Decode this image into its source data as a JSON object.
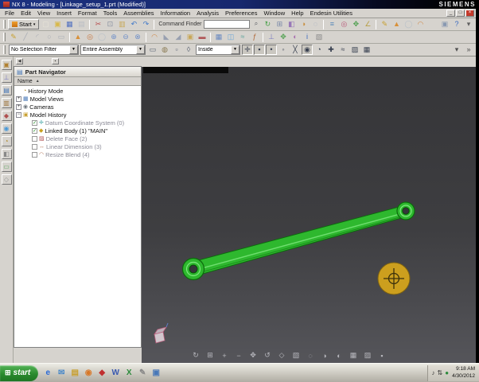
{
  "title_bar": {
    "title": "NX 8 - Modeling - [Linkage_setup_1.prt (Modified)]",
    "brand": "SIEMENS"
  },
  "menu": {
    "items": [
      "File",
      "Edit",
      "View",
      "Insert",
      "Format",
      "Tools",
      "Assemblies",
      "Information",
      "Analysis",
      "Preferences",
      "Window",
      "Help",
      "Endesin Utilities"
    ]
  },
  "window_controls": {
    "minimize": "_",
    "restore": "□",
    "close": "×"
  },
  "ui_glyphs": {
    "combo_arrow": "▼",
    "sort_asc": "▲",
    "check": "✓",
    "search": "⌕",
    "start_arrow": "▾",
    "navigator_header": "▤"
  },
  "toolbars": {
    "start_label": "Start",
    "command_finder": {
      "label": "Command Finder",
      "value": ""
    },
    "row1": [
      {
        "n": "new",
        "g": "▢",
        "c": "#e8e4d8"
      },
      {
        "n": "open",
        "g": "▣",
        "c": "#d8b84a"
      },
      {
        "n": "save",
        "g": "▦",
        "c": "#5070c0"
      },
      {
        "n": "print",
        "g": "▤",
        "c": "#b8bcc4"
      },
      {
        "sep": true
      },
      {
        "n": "cut",
        "g": "✂",
        "c": "#b85050"
      },
      {
        "n": "copy",
        "g": "⊡",
        "c": "#8890a0"
      },
      {
        "n": "paste",
        "g": "▥",
        "c": "#c8a858"
      },
      {
        "n": "undo",
        "g": "↶",
        "c": "#4078c8"
      },
      {
        "n": "redo",
        "g": "↷",
        "c": "#4078c8"
      },
      {
        "sep": true
      }
    ],
    "row1b": [
      {
        "n": "refresh",
        "g": "↻",
        "c": "#48a048"
      },
      {
        "n": "fit-view",
        "g": "⊞",
        "c": "#7888a8"
      },
      {
        "n": "orient-view",
        "g": "◧",
        "c": "#9878b8"
      },
      {
        "n": "shaded-view",
        "g": "◑",
        "c": "#c89040"
      },
      {
        "n": "wireframe-view",
        "g": "◌",
        "c": "#90a0b8"
      },
      {
        "sep": true
      },
      {
        "n": "layer-settings",
        "g": "≡",
        "c": "#5888b8"
      },
      {
        "n": "show-hide",
        "g": "◎",
        "c": "#b85878"
      },
      {
        "n": "move-object",
        "g": "✥",
        "c": "#50a050"
      },
      {
        "n": "measure-distance",
        "g": "∠",
        "c": "#b8a048"
      },
      {
        "sep": true
      },
      {
        "n": "sketch",
        "g": "✎",
        "c": "#c8a030"
      },
      {
        "n": "extrude",
        "g": "▲",
        "c": "#d89038"
      },
      {
        "n": "hole",
        "g": "◯",
        "c": "#b8c0c8"
      },
      {
        "n": "edge-blend",
        "g": "◠",
        "c": "#d08848"
      }
    ],
    "row1c": [
      {
        "n": "window-switch",
        "g": "▣",
        "c": "#8898b0"
      },
      {
        "n": "help",
        "g": "?",
        "c": "#3868c0"
      },
      {
        "n": "toolbar-options",
        "g": "▾",
        "c": "#606060"
      }
    ],
    "row2": [
      {
        "n": "sketch-in-task",
        "g": "✎",
        "c": "#c8a030"
      },
      {
        "n": "line",
        "g": "╱",
        "c": "#a8acb4"
      },
      {
        "n": "arc",
        "g": "◜",
        "c": "#a8acb4"
      },
      {
        "n": "circle",
        "g": "○",
        "c": "#a8acb4"
      },
      {
        "n": "rectangle",
        "g": "▭",
        "c": "#a8acb4"
      },
      {
        "sep": true
      },
      {
        "n": "extrude-feature",
        "g": "▲",
        "c": "#d89038"
      },
      {
        "n": "revolve",
        "g": "◎",
        "c": "#c87840"
      },
      {
        "n": "hole-feature",
        "g": "◯",
        "c": "#b8c0c8"
      },
      {
        "n": "unite",
        "g": "⊕",
        "c": "#7090c8"
      },
      {
        "n": "subtract",
        "g": "⊖",
        "c": "#7090c8"
      },
      {
        "n": "intersect",
        "g": "⊗",
        "c": "#7090c8"
      },
      {
        "sep": true
      },
      {
        "n": "edge-blend-feature",
        "g": "◠",
        "c": "#d08848"
      },
      {
        "n": "chamfer",
        "g": "◣",
        "c": "#98a0b0"
      },
      {
        "n": "draft",
        "g": "◢",
        "c": "#98a0b0"
      },
      {
        "n": "shell",
        "g": "▣",
        "c": "#c8a858"
      },
      {
        "n": "trim-body",
        "g": "▬",
        "c": "#b05858"
      },
      {
        "sep": true
      },
      {
        "n": "pattern-feature",
        "g": "▦",
        "c": "#6888c0"
      },
      {
        "n": "mirror-feature",
        "g": "◫",
        "c": "#70a8d8"
      },
      {
        "n": "wave-geometry-linker",
        "g": "≈",
        "c": "#58a098"
      },
      {
        "n": "expressions",
        "g": "ƒ",
        "c": "#b06838"
      },
      {
        "sep": true
      },
      {
        "n": "assembly-constraints",
        "g": "⊥",
        "c": "#7878c0"
      },
      {
        "n": "move-component",
        "g": "✥",
        "c": "#50a050"
      },
      {
        "n": "edit-object-display",
        "g": "◐",
        "c": "#a870b0"
      },
      {
        "n": "object-information",
        "g": "i",
        "c": "#3868c0"
      },
      {
        "n": "snapshot",
        "g": "▧",
        "c": "#888888"
      }
    ]
  },
  "selection_bar": {
    "filter_value": "No Selection Filter",
    "scope_value": "Entire Assembly",
    "inside_value": "Inside",
    "icons1": [
      {
        "n": "general-selection-filter",
        "g": "▭",
        "c": "#556070"
      },
      {
        "n": "highlight-selection",
        "g": "◍",
        "c": "#887850"
      },
      {
        "n": "top-selection-priority",
        "g": "▫",
        "c": "#606878"
      },
      {
        "n": "interior-edges",
        "g": "◊",
        "c": "#606878"
      }
    ],
    "icons2": [
      {
        "n": "snap-point",
        "g": "✛",
        "c": "#384050",
        "p": true
      },
      {
        "n": "end-point",
        "g": "▪",
        "c": "#384050",
        "p": true
      },
      {
        "n": "mid-point",
        "g": "•",
        "c": "#384050",
        "p": true
      },
      {
        "n": "control-point",
        "g": "◦",
        "c": "#384050"
      },
      {
        "n": "intersection-point",
        "g": "╳",
        "c": "#384050"
      },
      {
        "n": "arc-center",
        "g": "◉",
        "c": "#384050",
        "p": true
      },
      {
        "n": "quadrant-point",
        "g": "◔",
        "c": "#384050"
      },
      {
        "n": "existing-point",
        "g": "✚",
        "c": "#384050"
      },
      {
        "n": "point-on-curve",
        "g": "≈",
        "c": "#384050"
      },
      {
        "n": "point-on-face",
        "g": "▨",
        "c": "#384050"
      },
      {
        "n": "bounded-grid",
        "g": "▦",
        "c": "#384050"
      }
    ],
    "icons3": [
      {
        "n": "selection-options",
        "g": "▾",
        "c": "#505050"
      },
      {
        "n": "more-selection-tools",
        "g": "»",
        "c": "#505050"
      }
    ]
  },
  "resource_bar": {
    "tabs": [
      {
        "n": "assembly-navigator",
        "g": "▣",
        "c": "#b08030"
      },
      {
        "n": "constraint-navigator",
        "g": "⊥",
        "c": "#7878c0"
      },
      {
        "n": "part-navigator",
        "g": "▤",
        "c": "#4878b8"
      },
      {
        "n": "reuse-library",
        "g": "▥",
        "c": "#a07840"
      },
      {
        "n": "hd3d-tools",
        "g": "◆",
        "c": "#b05050"
      },
      {
        "n": "web-browser",
        "g": "◉",
        "c": "#4898d8"
      },
      {
        "n": "history-palette",
        "g": "◔",
        "c": "#b08a2a"
      },
      {
        "n": "system-materials",
        "g": "◧",
        "c": "#888888"
      },
      {
        "n": "roles",
        "g": "▭",
        "c": "#66aa66"
      },
      {
        "n": "touch-panel",
        "g": "◇",
        "c": "#999999"
      }
    ]
  },
  "navigator": {
    "dock": [
      {
        "n": "undock-panel",
        "g": "◀",
        "c": "#333333"
      },
      {
        "n": "pin-panel",
        "g": "▪",
        "c": "#333333"
      }
    ],
    "title": "Part Navigator",
    "column": "Name",
    "rows": [
      {
        "label": "History Mode",
        "level": 0,
        "exp": null,
        "g": "◔",
        "c": "#b08a2a",
        "check": null,
        "dim": false
      },
      {
        "label": "Model Views",
        "level": 0,
        "exp": "+",
        "g": "▦",
        "c": "#4878b8",
        "check": null,
        "dim": false
      },
      {
        "label": "Cameras",
        "level": 0,
        "exp": "+",
        "g": "◉",
        "c": "#707880",
        "check": null,
        "dim": false
      },
      {
        "label": "Model History",
        "level": 0,
        "exp": "-",
        "g": "▣",
        "c": "#c8a030",
        "check": null,
        "dim": false
      },
      {
        "label": "Datum Coordinate System (0)",
        "level": 1,
        "exp": null,
        "g": "✛",
        "c": "#38a0a0",
        "check": true,
        "dim": true
      },
      {
        "label": "Linked Body (1) \"MAIN\"",
        "level": 1,
        "exp": null,
        "g": "◆",
        "c": "#c8a020",
        "check": true,
        "dim": false
      },
      {
        "label": "Delete Face (2)",
        "level": 1,
        "exp": null,
        "g": "▨",
        "c": "#b05050",
        "check": false,
        "dim": true
      },
      {
        "label": "Linear Dimension (3)",
        "level": 1,
        "exp": null,
        "g": "↔",
        "c": "#b07050",
        "check": false,
        "dim": true
      },
      {
        "label": "Resize Blend (4)",
        "level": 1,
        "exp": null,
        "g": "◠",
        "c": "#b07050",
        "check": false,
        "dim": true
      }
    ]
  },
  "graphics": {
    "colors": {
      "part": "#2eb82e",
      "part_dark": "#0c6a0c",
      "part_light": "#7fe87f",
      "hole": "#35353a",
      "target": "#d4a41c"
    },
    "view_icons": [
      {
        "n": "refresh-view",
        "g": "↻"
      },
      {
        "n": "fit-view",
        "g": "⊞"
      },
      {
        "n": "zoom-in",
        "g": "+"
      },
      {
        "n": "zoom-out",
        "g": "−"
      },
      {
        "n": "pan-view",
        "g": "✥"
      },
      {
        "n": "rotate-view",
        "g": "↺"
      },
      {
        "n": "perspective",
        "g": "◇"
      },
      {
        "n": "snapshot-view",
        "g": "▧"
      },
      {
        "n": "wireframe",
        "g": "◌"
      },
      {
        "n": "shaded",
        "g": "◑"
      },
      {
        "n": "studio-render",
        "g": "◐"
      },
      {
        "n": "face-edges",
        "g": "▦"
      },
      {
        "n": "clip-section",
        "g": "▨"
      },
      {
        "n": "lock-rotation",
        "g": "▪"
      }
    ]
  },
  "taskbar": {
    "start_label": "start",
    "flag": "⊞",
    "quick": [
      {
        "n": "internet-explorer",
        "g": "e",
        "c": "#2a6ad8"
      },
      {
        "n": "email-client",
        "g": "✉",
        "c": "#4888c8"
      },
      {
        "n": "file-explorer",
        "g": "▤",
        "c": "#c8a030"
      },
      {
        "n": "media-player",
        "g": "◉",
        "c": "#d87828"
      },
      {
        "n": "nx-application",
        "g": "◆",
        "c": "#c03030"
      },
      {
        "n": "word-processor",
        "g": "W",
        "c": "#3858b0"
      },
      {
        "n": "spreadsheet",
        "g": "X",
        "c": "#2a8a3a"
      },
      {
        "n": "notepad",
        "g": "✎",
        "c": "#888888"
      },
      {
        "n": "show-desktop",
        "g": "▣",
        "c": "#4878b8"
      }
    ],
    "tray_icons": [
      {
        "n": "volume",
        "g": "♪",
        "c": "#333333"
      },
      {
        "n": "network",
        "g": "⇅",
        "c": "#333333"
      },
      {
        "n": "security-center",
        "g": "●",
        "c": "#2a8a3a"
      }
    ],
    "time": "9:18 AM",
    "date": "4/30/2012"
  }
}
